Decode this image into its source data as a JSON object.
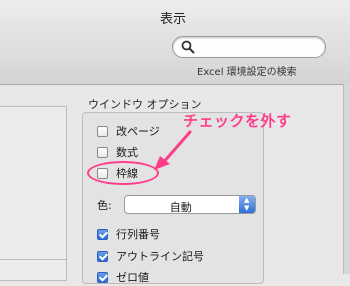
{
  "window": {
    "title": "表示"
  },
  "search": {
    "placeholder": "",
    "caption": "Excel 環境設定の検索"
  },
  "window_options": {
    "title": "ウインドウ オプション",
    "checkboxes": [
      {
        "label": "改ページ",
        "checked": false
      },
      {
        "label": "数式",
        "checked": false
      },
      {
        "label": "枠線",
        "checked": false
      }
    ],
    "color": {
      "label": "色:",
      "value": "自動"
    },
    "checkboxes2": [
      {
        "label": "行列番号",
        "checked": true
      },
      {
        "label": "アウトライン記号",
        "checked": true
      },
      {
        "label": "ゼロ値",
        "checked": true
      }
    ]
  },
  "annotation": {
    "text": "チェックを外す",
    "color": "#ff3d8a"
  }
}
